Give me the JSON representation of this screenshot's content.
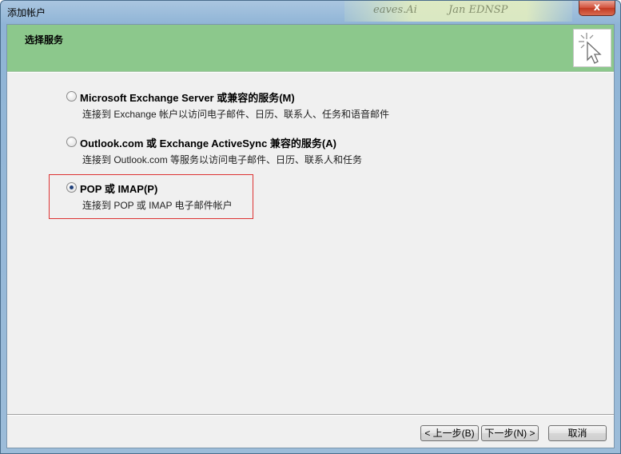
{
  "window": {
    "title": "添加帐户",
    "title_deco_text_1": "eaves.Ai",
    "title_deco_text_2": "Jan EDNSP",
    "close_label": "x"
  },
  "header": {
    "title": "选择服务",
    "icon": "cursor-click-icon"
  },
  "options": [
    {
      "label": "Microsoft Exchange Server 或兼容的服务(M)",
      "description": "连接到 Exchange 帐户以访问电子邮件、日历、联系人、任务和语音邮件",
      "checked": false
    },
    {
      "label": "Outlook.com 或 Exchange ActiveSync 兼容的服务(A)",
      "description": "连接到 Outlook.com 等服务以访问电子邮件、日历、联系人和任务",
      "checked": false
    },
    {
      "label": "POP 或 IMAP(P)",
      "description": "连接到 POP 或 IMAP 电子邮件帐户",
      "checked": true
    }
  ],
  "buttons": {
    "back": "< 上一步(B)",
    "next": "下一步(N) >",
    "cancel": "取消"
  },
  "colors": {
    "header_bg": "#8cc88c",
    "highlight_border": "#dd3333"
  }
}
